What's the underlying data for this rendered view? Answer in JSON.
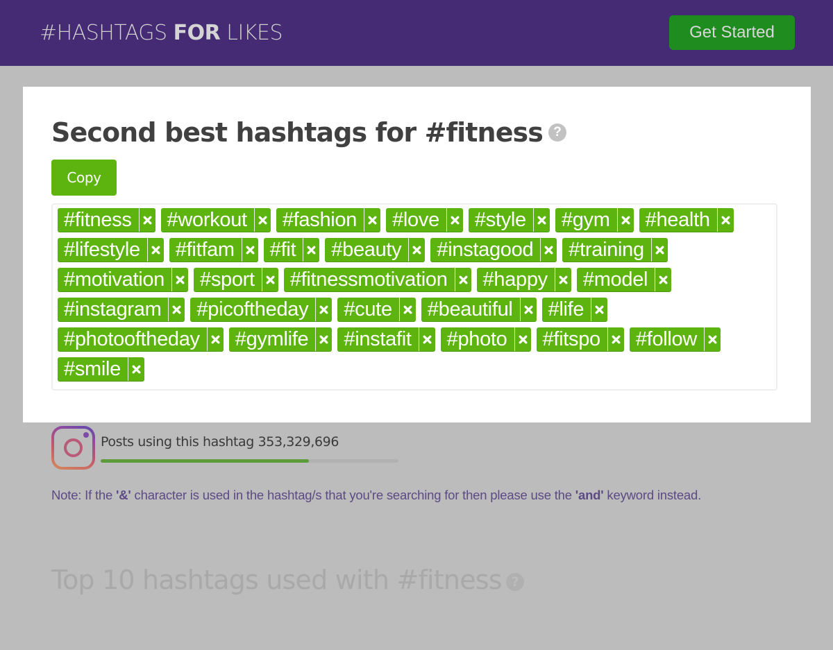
{
  "header": {
    "logo": {
      "prefix": "#HASHTAGS ",
      "bold": "FOR",
      "suffix": " LIKES"
    },
    "cta_label": "Get Started"
  },
  "colors": {
    "header_bg": "#452a74",
    "cta_bg": "#1f8c1f",
    "tag_bg": "#5db40f",
    "note_text": "#5c4a85",
    "progress_fill": "#5d9b3a"
  },
  "modal": {
    "title": "Second best hashtags for #fitness",
    "help_icon": "question-circle-icon",
    "help_glyph": "?",
    "copy_label": "Copy",
    "remove_icon": "close-icon",
    "tags": [
      "#fitness",
      "#workout",
      "#fashion",
      "#love",
      "#style",
      "#gym",
      "#health",
      "#lifestyle",
      "#fitfam",
      "#fit",
      "#beauty",
      "#instagood",
      "#training",
      "#motivation",
      "#sport",
      "#fitnessmotivation",
      "#happy",
      "#model",
      "#instagram",
      "#picoftheday",
      "#cute",
      "#beautiful",
      "#life",
      "#photooftheday",
      "#gymlife",
      "#instafit",
      "#photo",
      "#fitspo",
      "#follow",
      "#smile"
    ]
  },
  "background": {
    "posts": {
      "icon": "instagram-icon",
      "label": "Posts using this hashtag 353,329,696",
      "progress_fraction": 0.7
    },
    "note": {
      "p1": "Note: If the ",
      "b1": "'&'",
      "p2": " character is used in the hashtag/s that you're searching for then please use the ",
      "b2": "'and'",
      "p3": " keyword instead."
    },
    "top10_title": "Top 10 hashtags used with #fitness",
    "help_glyph": "?"
  }
}
